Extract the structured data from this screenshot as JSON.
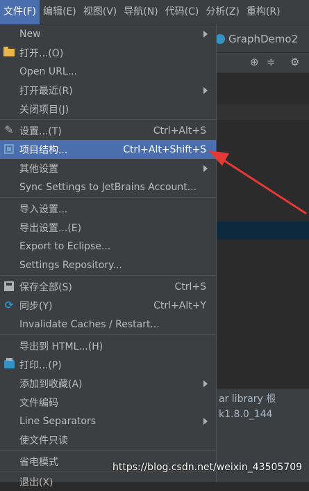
{
  "menubar": {
    "items": [
      {
        "label": "文件(F)",
        "active": true
      },
      {
        "label": "编辑(E)"
      },
      {
        "label": "视图(V)"
      },
      {
        "label": "导航(N)"
      },
      {
        "label": "代码(C)"
      },
      {
        "label": "分析(Z)"
      },
      {
        "label": "重构(R)"
      }
    ]
  },
  "editor": {
    "tab_label": "GraphDemo2",
    "lower_text_1": "ar  library 根",
    "lower_text_2": "k1.8.0_144"
  },
  "menu": {
    "items": [
      {
        "label": "New",
        "submenu": true
      },
      {
        "label": "打开...(O)",
        "icon": "folder-icon"
      },
      {
        "label": "Open URL..."
      },
      {
        "label": "打开最近(R)",
        "submenu": true
      },
      {
        "label": "关闭项目(J)"
      },
      {
        "label": "设置...(T)",
        "shortcut": "Ctrl+Alt+S",
        "icon": "wrench-icon"
      },
      {
        "label": "项目结构...",
        "shortcut": "Ctrl+Alt+Shift+S",
        "icon": "project-structure-icon",
        "selected": true
      },
      {
        "label": "其他设置",
        "submenu": true
      },
      {
        "label": "Sync Settings to JetBrains Account..."
      },
      {
        "label": "导入设置..."
      },
      {
        "label": "导出设置...(E)"
      },
      {
        "label": "Export to Eclipse..."
      },
      {
        "label": "Settings Repository..."
      },
      {
        "label": "保存全部(S)",
        "shortcut": "Ctrl+S",
        "icon": "save-icon"
      },
      {
        "label": "同步(Y)",
        "shortcut": "Ctrl+Alt+Y",
        "icon": "sync-icon"
      },
      {
        "label": "Invalidate Caches / Restart..."
      },
      {
        "label": "导出到 HTML...(H)"
      },
      {
        "label": "打印...(P)",
        "icon": "print-icon"
      },
      {
        "label": "添加到收藏(A)",
        "submenu": true
      },
      {
        "label": "文件编码"
      },
      {
        "label": "Line Separators",
        "submenu": true
      },
      {
        "label": "使文件只读"
      },
      {
        "label": "省电模式"
      },
      {
        "label": "退出(X)"
      }
    ]
  },
  "watermark": "https://blog.csdn.net/weixin_43505709",
  "colors": {
    "menu_bg": "#3c3f41",
    "selection": "#4b6eaf",
    "annotation_arrow": "#e53935"
  }
}
